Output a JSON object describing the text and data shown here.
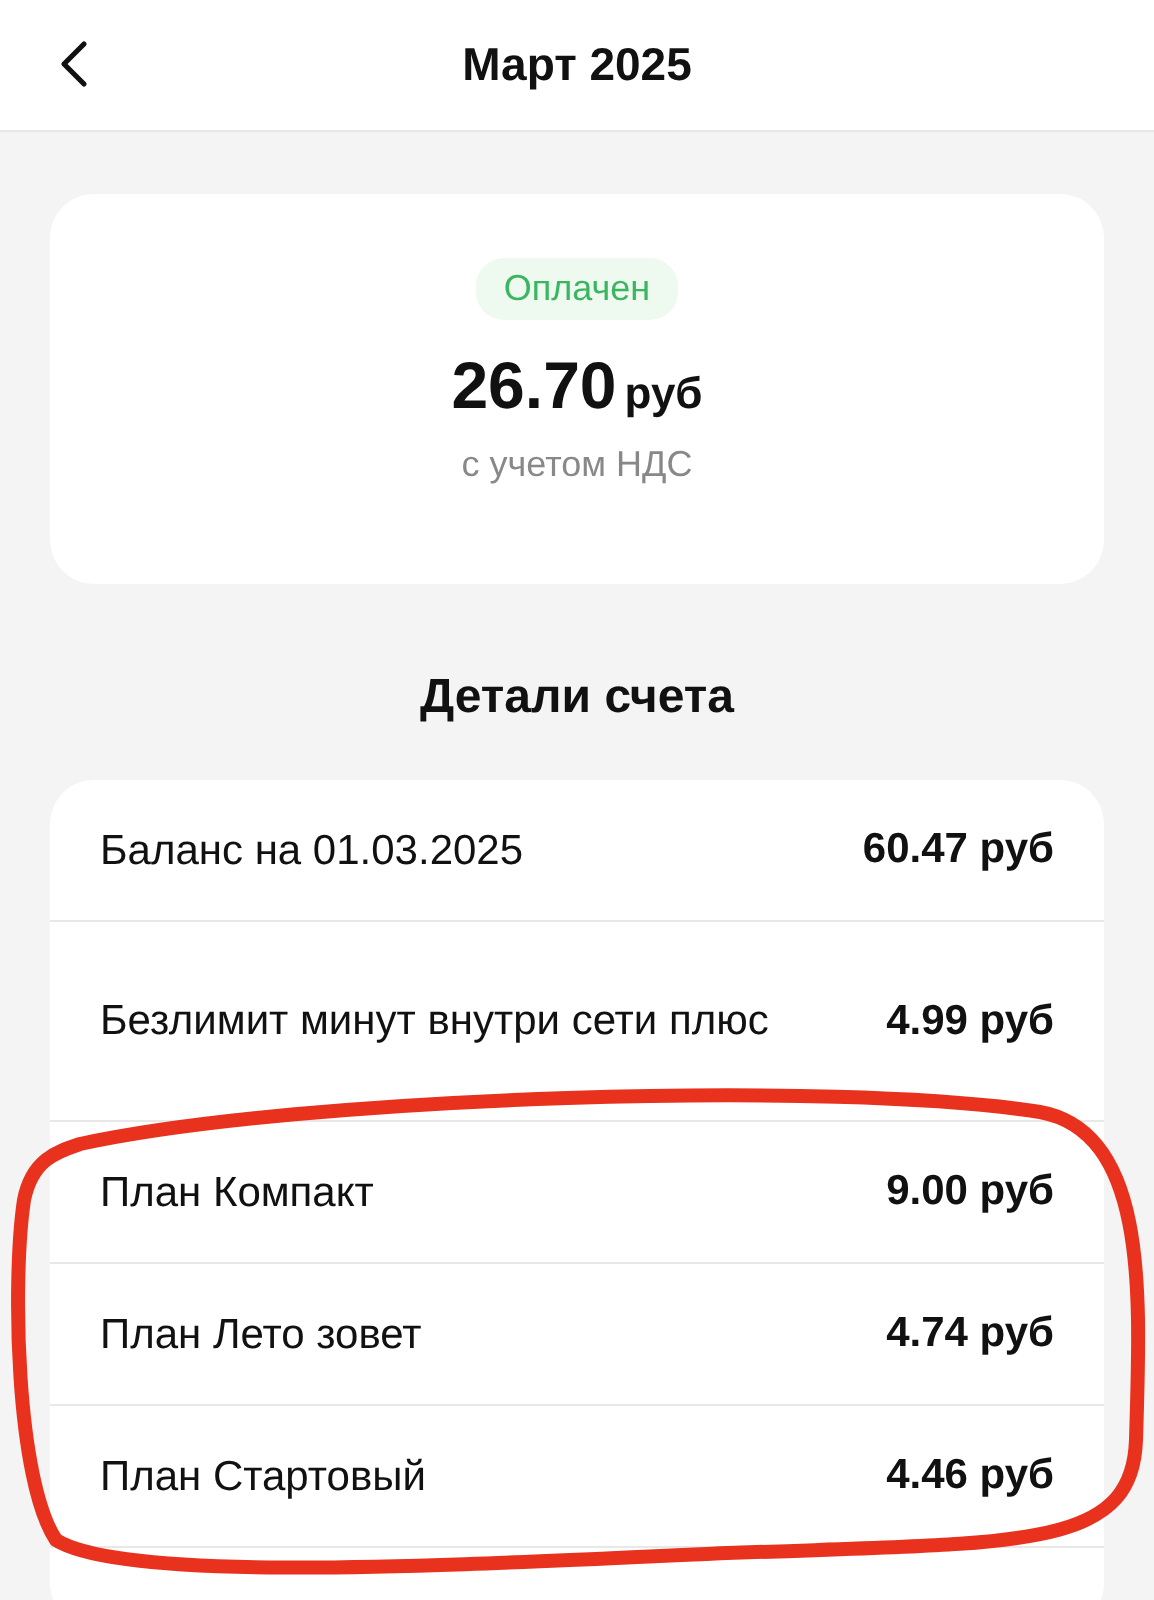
{
  "header": {
    "title": "Март 2025"
  },
  "summary": {
    "status": "Оплачен",
    "amount": "26.70",
    "currency": "руб",
    "note": "с учетом НДС"
  },
  "details_title": "Детали счета",
  "details": [
    {
      "kind": "item",
      "label": "Баланс на 01.03.2025",
      "value": "60.47 руб"
    },
    {
      "kind": "item",
      "label": "Безлимит минут внутри сети плюс",
      "value": "4.99 руб"
    },
    {
      "kind": "item",
      "label": "План Компакт",
      "value": "9.00 руб"
    },
    {
      "kind": "item",
      "label": "План Лето зовет",
      "value": "4.74 руб"
    },
    {
      "kind": "item",
      "label": "План Стартовый",
      "value": "4.46 руб"
    },
    {
      "kind": "cut-off"
    }
  ],
  "annotation": {
    "kind": "ellipse"
  }
}
